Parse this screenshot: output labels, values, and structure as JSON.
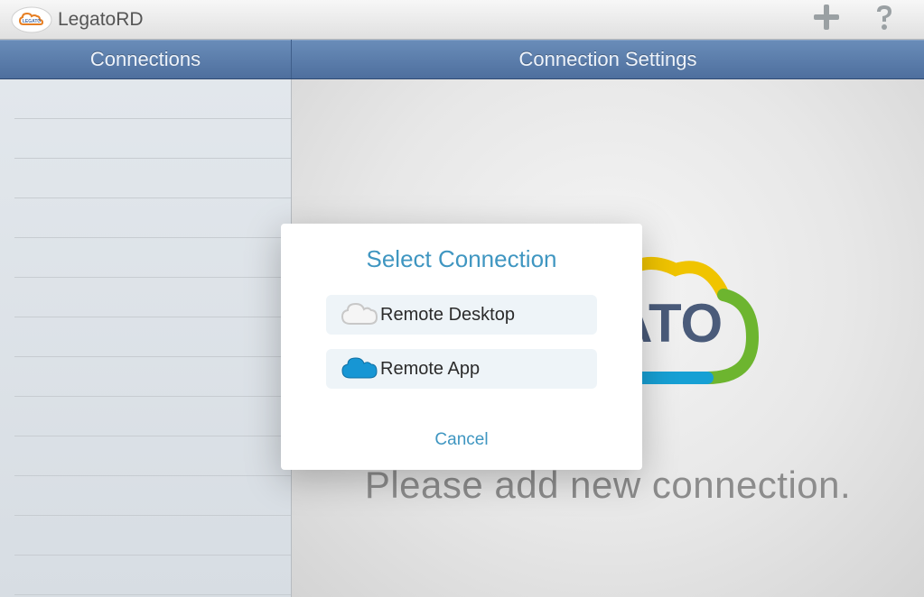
{
  "app": {
    "title": "LegatoRD"
  },
  "header": {
    "connections_label": "Connections",
    "settings_label": "Connection Settings"
  },
  "main": {
    "prompt": "Please add new connection."
  },
  "dialog": {
    "title": "Select Connection",
    "options": [
      {
        "label": "Remote Desktop"
      },
      {
        "label": "Remote App"
      }
    ],
    "cancel_label": "Cancel"
  }
}
